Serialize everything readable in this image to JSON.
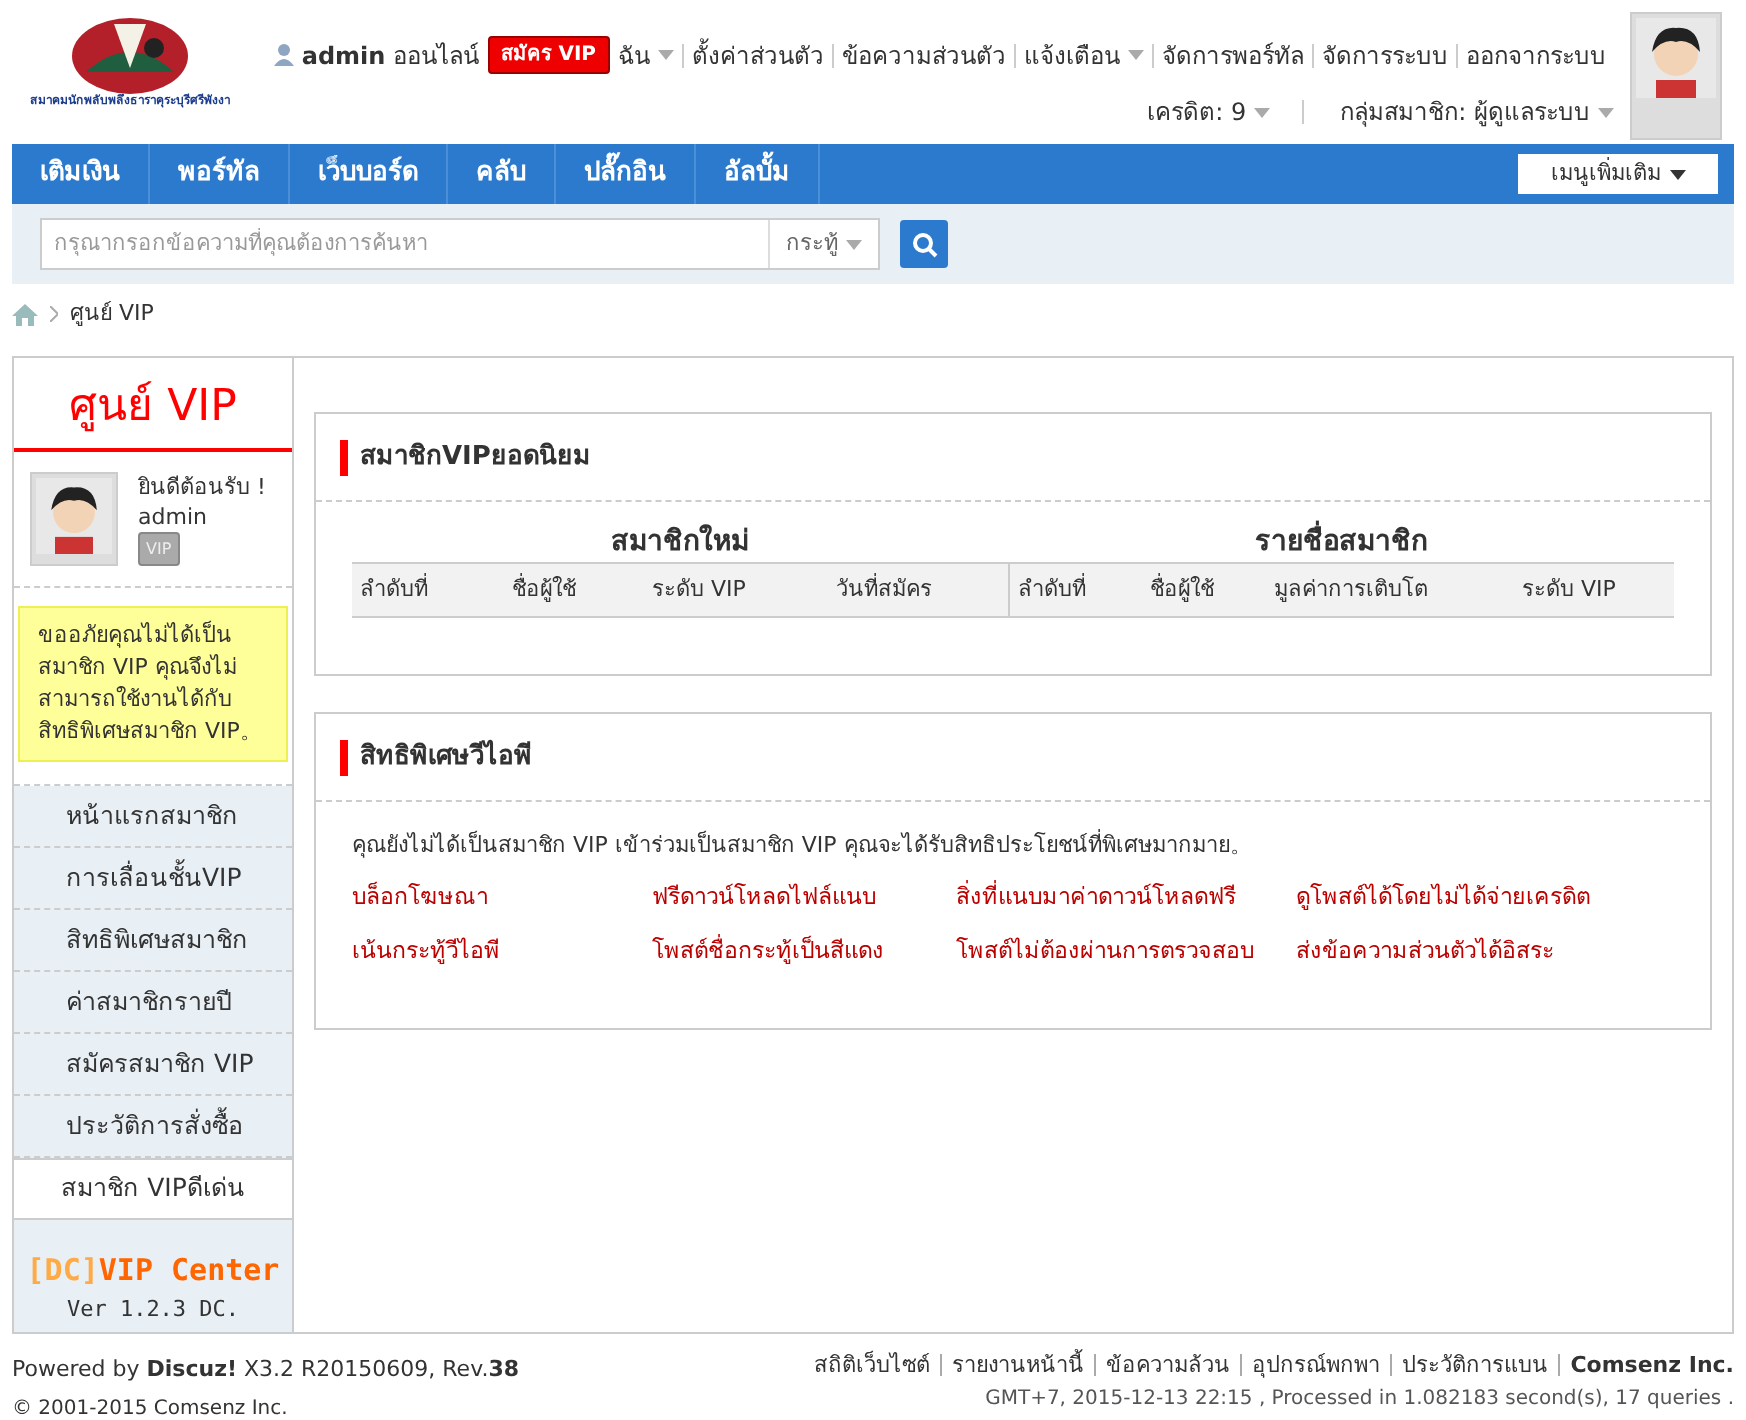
{
  "logo": {
    "caption": "สมาคมนักพลับพลึงธาราคุระบุรีศรีพังงา"
  },
  "user_bar": {
    "username": "admin",
    "online": "ออนไลน์",
    "vip_button": "สมัคร VIP",
    "links": [
      {
        "label": "ฉัน",
        "dropdown": true
      },
      {
        "label": "ตั้งค่าส่วนตัว",
        "dropdown": false
      },
      {
        "label": "ข้อความส่วนตัว",
        "dropdown": false
      },
      {
        "label": "แจ้งเตือน",
        "dropdown": true
      },
      {
        "label": "จัดการพอร์ทัล",
        "dropdown": false
      },
      {
        "label": "จัดการระบบ",
        "dropdown": false
      },
      {
        "label": "ออกจากระบบ",
        "dropdown": false
      }
    ],
    "credit": "เครดิต: 9",
    "group": "กลุ่มสมาชิก: ผู้ดูแลระบบ"
  },
  "nav": {
    "items": [
      {
        "label": "เติมเงิน",
        "selected": false
      },
      {
        "label": "พอร์ทัล",
        "selected": false
      },
      {
        "label": "เว็บบอร์ด",
        "selected": false
      },
      {
        "label": "คลับ",
        "selected": false
      },
      {
        "label": "ปลั๊กอิน",
        "selected": false
      },
      {
        "label": "อัลบั้ม",
        "selected": false
      }
    ],
    "more": "เมนูเพิ่มเติม"
  },
  "search": {
    "placeholder": "กรุณากรอกข้อความที่คุณต้องการค้นหา",
    "scope": "กระทู้"
  },
  "breadcrumb": "ศูนย์ VIP",
  "sidebar": {
    "title": "ศูนย์ VIP",
    "welcome": "ยินดีต้อนรับ !",
    "username": "admin",
    "badge": "VIP",
    "notice": "ขออภัยคุณไม่ได้เป็นสมาชิก VIP คุณจึงไม่สามารถใช้งานได้กับสิทธิพิเศษสมาชิก VIP。",
    "items": [
      {
        "label": "หน้าแรกสมาชิก",
        "selected": false
      },
      {
        "label": "การเลื่อนชั้นVIP",
        "selected": false
      },
      {
        "label": "สิทธิพิเศษสมาชิก",
        "selected": false
      },
      {
        "label": "ค่าสมาชิกรายปี",
        "selected": false
      },
      {
        "label": "สมัครสมาชิก VIP",
        "selected": false
      },
      {
        "label": "ประวัติการสั่งซื้อ",
        "selected": false
      },
      {
        "label": "สมาชิก VIPดีเด่น",
        "selected": true
      }
    ],
    "brand_tag": "[DC]",
    "brand_name": "VIP Center",
    "version": "Ver 1.2.3 DC."
  },
  "popular": {
    "title": "สมาชิกVIPยอดนิยม",
    "tables": [
      {
        "title": "สมาชิกใหม่",
        "columns": [
          "ลำดับที่",
          "ชื่อผู้ใช้",
          "ระดับ VIP",
          "วันที่สมัคร"
        ]
      },
      {
        "title": "รายชื่อสมาชิก",
        "columns": [
          "ลำดับที่",
          "ชื่อผู้ใช้",
          "มูลค่าการเติบโต",
          "ระดับ VIP"
        ]
      }
    ]
  },
  "privileges": {
    "title": "สิทธิพิเศษวีไอพี",
    "intro": "คุณยังไม่ได้เป็นสมาชิก VIP เข้าร่วมเป็นสมาชิก VIP คุณจะได้รับสิทธิประโยชน์ที่พิเศษมากมาย。",
    "items": [
      "บล็อกโฆษณา",
      "ฟรีดาวน์โหลดไฟล์แนบ",
      "สิ่งที่แนบมาค่าดาวน์โหลดฟรี",
      "ดูโพสต์ได้โดยไม่ได้จ่ายเครดิต",
      "เน้นกระทู้วีไอพี",
      "โพสต์ชื่อกระทู้เป็นสีแดง",
      "โพสต์ไม่ต้องผ่านการตรวจสอบ",
      "ส่งข้อความส่วนตัวได้อิสระ"
    ]
  },
  "footer": {
    "powered": "Powered by **Discuz!** X3.2 R20150609, Rev.**38**",
    "copyright": "© 2001-2015 Comsenz Inc.",
    "links": [
      "สถิติเว็บไซต์",
      "รายงานหน้านี้",
      "ข้อความล้วน",
      "อุปกรณ์พกพา",
      "ประวัติการแบน"
    ],
    "company": "Comsenz Inc.",
    "stats": "GMT+7, 2015-12-13 22:15 , Processed in 1.082183 second(s), 17 queries ."
  }
}
